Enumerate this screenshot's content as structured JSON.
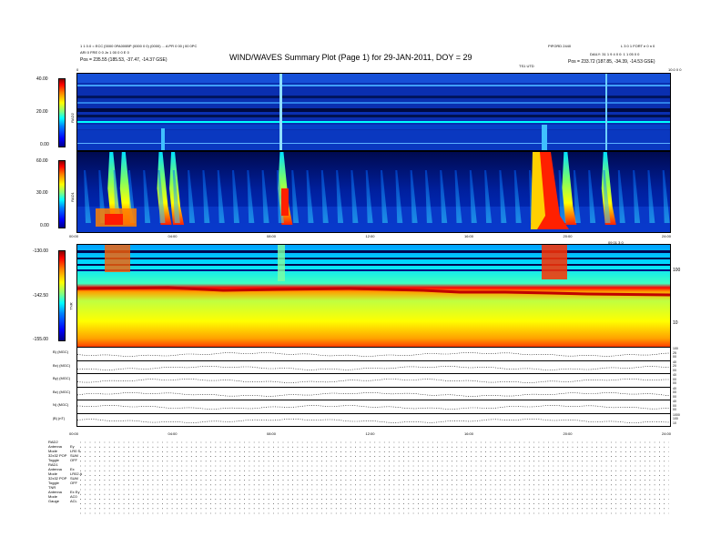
{
  "header": {
    "title": "WIND/WAVES Summary Plot (Page 1) for 29-JAN-2011, DOY = 29",
    "left_line1": "1 1 0.0 = ECC [0000 0FA000BP (0000 0 0) (0000) ... A PR 0 00 j 00 0PC",
    "left_line2": "ARI 0 FRE 0 0 Jn 1 00 0 0 E 0",
    "left_line3": "Pos = 235.55 (185.53, -37.47, -14.37 GSE)",
    "mid_label": "TS1 UTD",
    "right_top1": "PIFORD 2440",
    "right_top2": "L 3 0 1 FORT e 0 n 0",
    "right_line2": "DAILY: 31 1 9 4 0 0: 1 1 05 0 0",
    "right_line3": "Pos = 233.72 (187.85, -34.39, -14.53 GSE)",
    "corner_left": "0",
    "corner_right": "10.0 0 0"
  },
  "rad2": {
    "label": "RAD2",
    "ticks": [
      "40.00",
      "20.00",
      "0.00"
    ]
  },
  "rad1": {
    "label": "RAD1",
    "ticks": [
      "60.00",
      "30.00",
      "0.00"
    ]
  },
  "time_axis": {
    "ticks": [
      "00:00",
      "04:00",
      "08:00",
      "12:00",
      "16:00",
      "20:00",
      "24:00"
    ],
    "right_label": "09 01 3 0"
  },
  "tnr": {
    "label": "TNR",
    "ticks": [
      "-130.00",
      "-142.50",
      "-155.00"
    ],
    "right_ticks": [
      "100",
      "10"
    ]
  },
  "line_panels": [
    {
      "label": "B) (MGC)",
      "right_ticks": [
        "100",
        "25",
        "00"
      ]
    },
    {
      "label": "Bx) (MGC)",
      "right_ticks": [
        "40",
        "20",
        "00"
      ]
    },
    {
      "label": "By) (MGC)",
      "right_ticks": [
        "40",
        "00",
        "00"
      ]
    },
    {
      "label": "Bz) (MGC)",
      "right_ticks": [
        "40",
        "00",
        "00"
      ]
    },
    {
      "label": "N) (MGC)",
      "right_ticks": [
        "40",
        "00",
        "00"
      ]
    },
    {
      "label": "|B| (nT)",
      "right_ticks": [
        "1000",
        "100",
        "10"
      ]
    }
  ],
  "bottom_time_ticks": [
    "00:00",
    "04:00",
    "08:00",
    "12:00",
    "16:00",
    "20:00",
    "24:00"
  ],
  "footer": {
    "blocks": [
      {
        "head": "RAD2",
        "rows": [
          [
            "Antenna",
            "Ey"
          ],
          [
            "Mode",
            "LR0 S"
          ],
          [
            "32x32 POP",
            "SUM"
          ],
          [
            "Toggle",
            "OFF"
          ]
        ]
      },
      {
        "head": "RAD1",
        "rows": [
          [
            "Antenna",
            "Ex"
          ],
          [
            "Mode",
            "LR02 A"
          ],
          [
            "32x32 POP",
            "SUM"
          ],
          [
            "Toggle",
            "OFF"
          ]
        ]
      },
      {
        "head": "TNR",
        "rows": [
          [
            "Antenna",
            "Ex Ey"
          ],
          [
            "Mode",
            "AC0"
          ],
          [
            "Gauge",
            "ACL"
          ]
        ]
      }
    ]
  },
  "chart_data": {
    "type": "heatmap",
    "title": "WIND/WAVES Summary Plot (Page 1) for 29-JAN-2011, DOY = 29",
    "x_range": [
      "00:00",
      "24:00"
    ],
    "panels": [
      {
        "name": "RAD2",
        "ylim": [
          0,
          40
        ],
        "colorscale": "jet"
      },
      {
        "name": "RAD1",
        "ylim": [
          0,
          60
        ],
        "colorscale": "jet"
      },
      {
        "name": "TNR",
        "ylim": [
          -155,
          -130
        ],
        "colorscale": "jet"
      }
    ],
    "colors": {
      "background_low": "#00108a",
      "mid": "#00ffff",
      "high": "#ff0000"
    },
    "bursts_hours": [
      1.3,
      1.8,
      3.3,
      3.8,
      8.2,
      18.9,
      19.7,
      21.3
    ]
  }
}
